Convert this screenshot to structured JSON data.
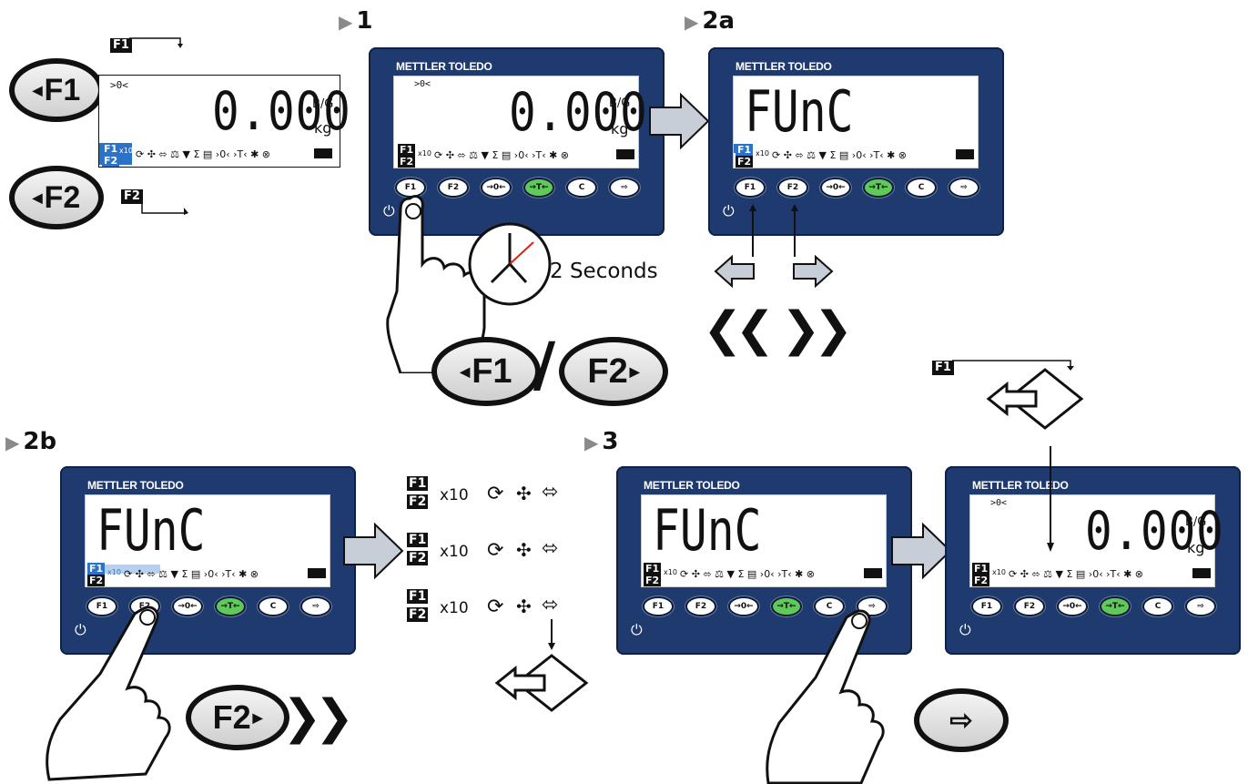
{
  "steps": {
    "s1": "1",
    "s2a": "2a",
    "s2b": "2b",
    "s3": "3"
  },
  "brand": "METTLER TOLEDO",
  "lcd": {
    "zero_indicator": ">0<",
    "weight": "0.000",
    "unit_top": "B/G",
    "unit_bottom": "kg",
    "func_text": "FUnC",
    "f1": "F1",
    "f2": "F2",
    "x10": "x10",
    "icons": "⟳ ✣ ⬄ ⚖ ▼ Σ ▤ ›0‹ ›T‹ ✱ ⊗"
  },
  "keys": [
    "F1",
    "F2",
    "→0←",
    "→T←",
    "C",
    "⇨"
  ],
  "callouts": {
    "f1": "F1",
    "f2": "F2",
    "slash": "/",
    "two_seconds": "2 Seconds"
  },
  "menu": {
    "f1": "F1",
    "f2": "F2",
    "x10": "x10"
  },
  "colors": {
    "terminal": "#1f3a6e",
    "green_key": "#5fc95a",
    "highlight": "#2b73c9"
  }
}
